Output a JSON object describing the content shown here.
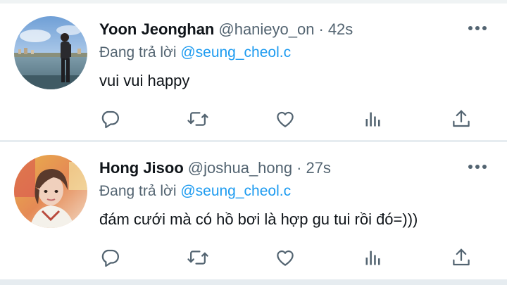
{
  "colors": {
    "accent": "#1d9bf0",
    "secondary_text": "#536471",
    "primary_text": "#0f1419",
    "icon": "#536471"
  },
  "tweets": [
    {
      "display_name": "Yoon Jeonghan",
      "handle": "@hanieyo_on",
      "separator": "·",
      "time": "42s",
      "reply_prefix": "Đang trả lời",
      "reply_to": "@seung_cheol.c",
      "text": "vui vui happy",
      "avatar": "avatar-photo-lakeside",
      "actions": [
        "reply-icon",
        "retweet-icon",
        "like-icon",
        "views-icon",
        "share-icon"
      ]
    },
    {
      "display_name": "Hong Jisoo",
      "handle": "@joshua_hong",
      "separator": "·",
      "time": "27s",
      "reply_prefix": "Đang trả lời",
      "reply_to": "@seung_cheol.c",
      "text": "đám cưới mà có hồ bơi là hợp gu tui rồi đó=)))",
      "avatar": "avatar-photo-portrait",
      "actions": [
        "reply-icon",
        "retweet-icon",
        "like-icon",
        "views-icon",
        "share-icon"
      ]
    }
  ]
}
